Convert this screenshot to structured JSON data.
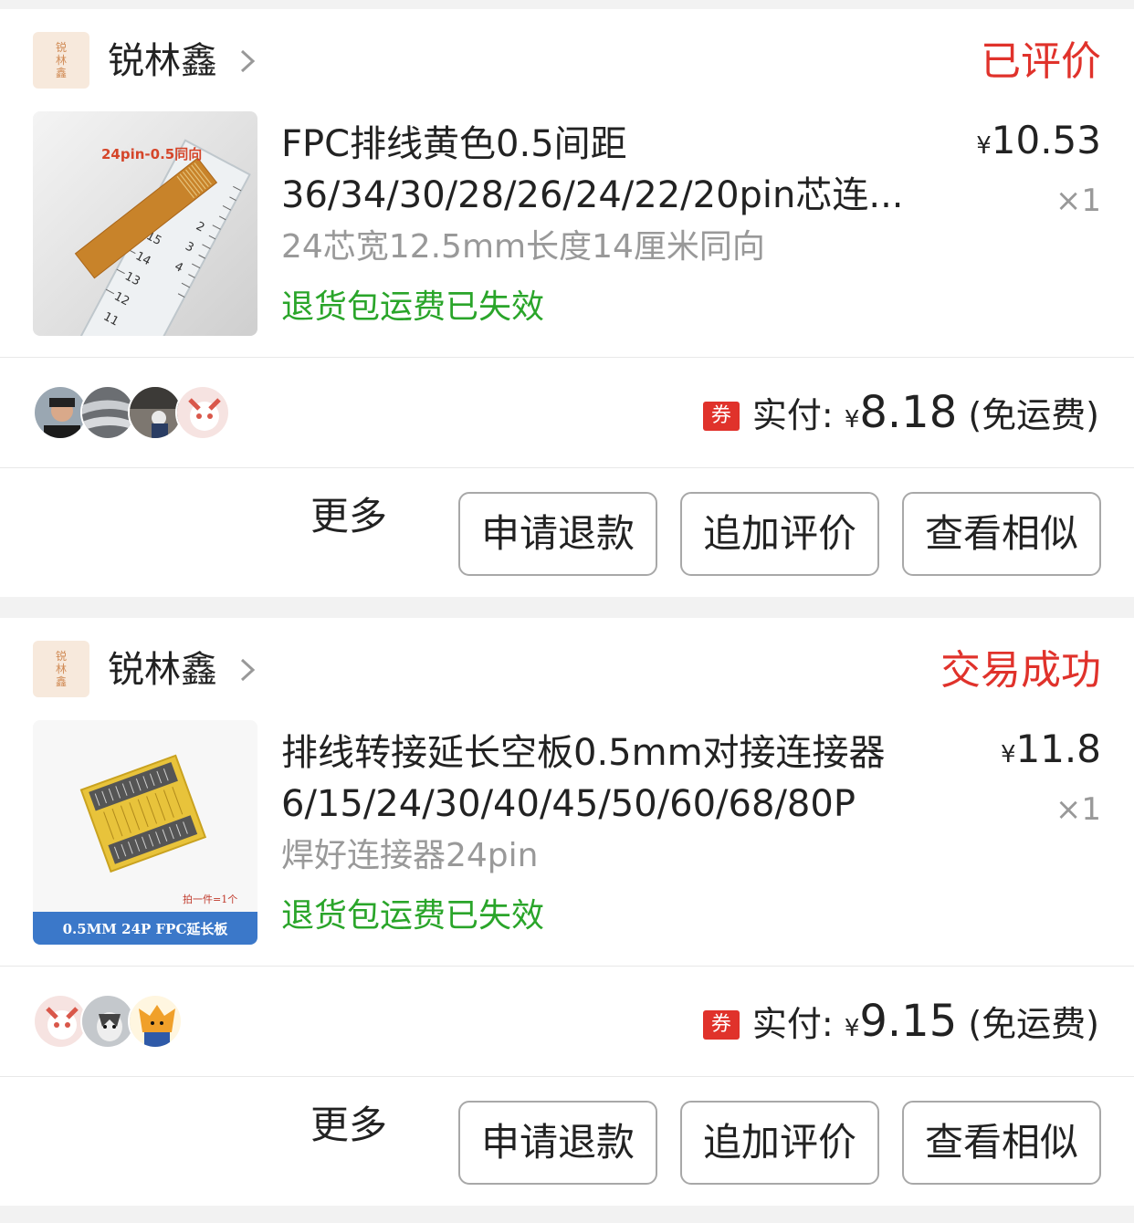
{
  "orders": [
    {
      "shop_name": "锐林鑫",
      "shop_logo_text": "锐林鑫",
      "status": "已评价",
      "product": {
        "title": "FPC排线黄色0.5间距36/34/30/28/26/24/22/20pin芯连...",
        "thumb_label": "24pin-0.5同向",
        "ruler_numbers": [
          "15",
          "14",
          "13",
          "12",
          "11",
          "2",
          "3",
          "4"
        ],
        "sku": "24芯宽12.5mm长度14厘米同向",
        "return_note": "退货包运费已失效",
        "price_symbol": "¥",
        "price": "10.53",
        "quantity": "×1"
      },
      "payment": {
        "coupon": "券",
        "label": "实付:",
        "symbol": "¥",
        "amount": "8.18",
        "shipping": "(免运费)"
      },
      "actions": {
        "more": "更多",
        "refund": "申请退款",
        "add_review": "追加评价",
        "similar": "查看相似"
      }
    },
    {
      "shop_name": "锐林鑫",
      "shop_logo_text": "锐林鑫",
      "status": "交易成功",
      "product": {
        "title": "排线转接延长空板0.5mm对接连接器6/15/24/30/40/45/50/60/68/80P",
        "thumb_label": "0.5MM 24P FPC延长板",
        "thumb_note": "拍一件=1个",
        "sku": "焊好连接器24pin",
        "return_note": "退货包运费已失效",
        "price_symbol": "¥",
        "price": "11.8",
        "quantity": "×1"
      },
      "payment": {
        "coupon": "券",
        "label": "实付:",
        "symbol": "¥",
        "amount": "9.15",
        "shipping": "(免运费)"
      },
      "actions": {
        "more": "更多",
        "refund": "申请退款",
        "add_review": "追加评价",
        "similar": "查看相似"
      }
    }
  ],
  "colors": {
    "status_red": "#e0322b",
    "return_green": "#2aa52a",
    "coupon_red": "#e0322b"
  }
}
